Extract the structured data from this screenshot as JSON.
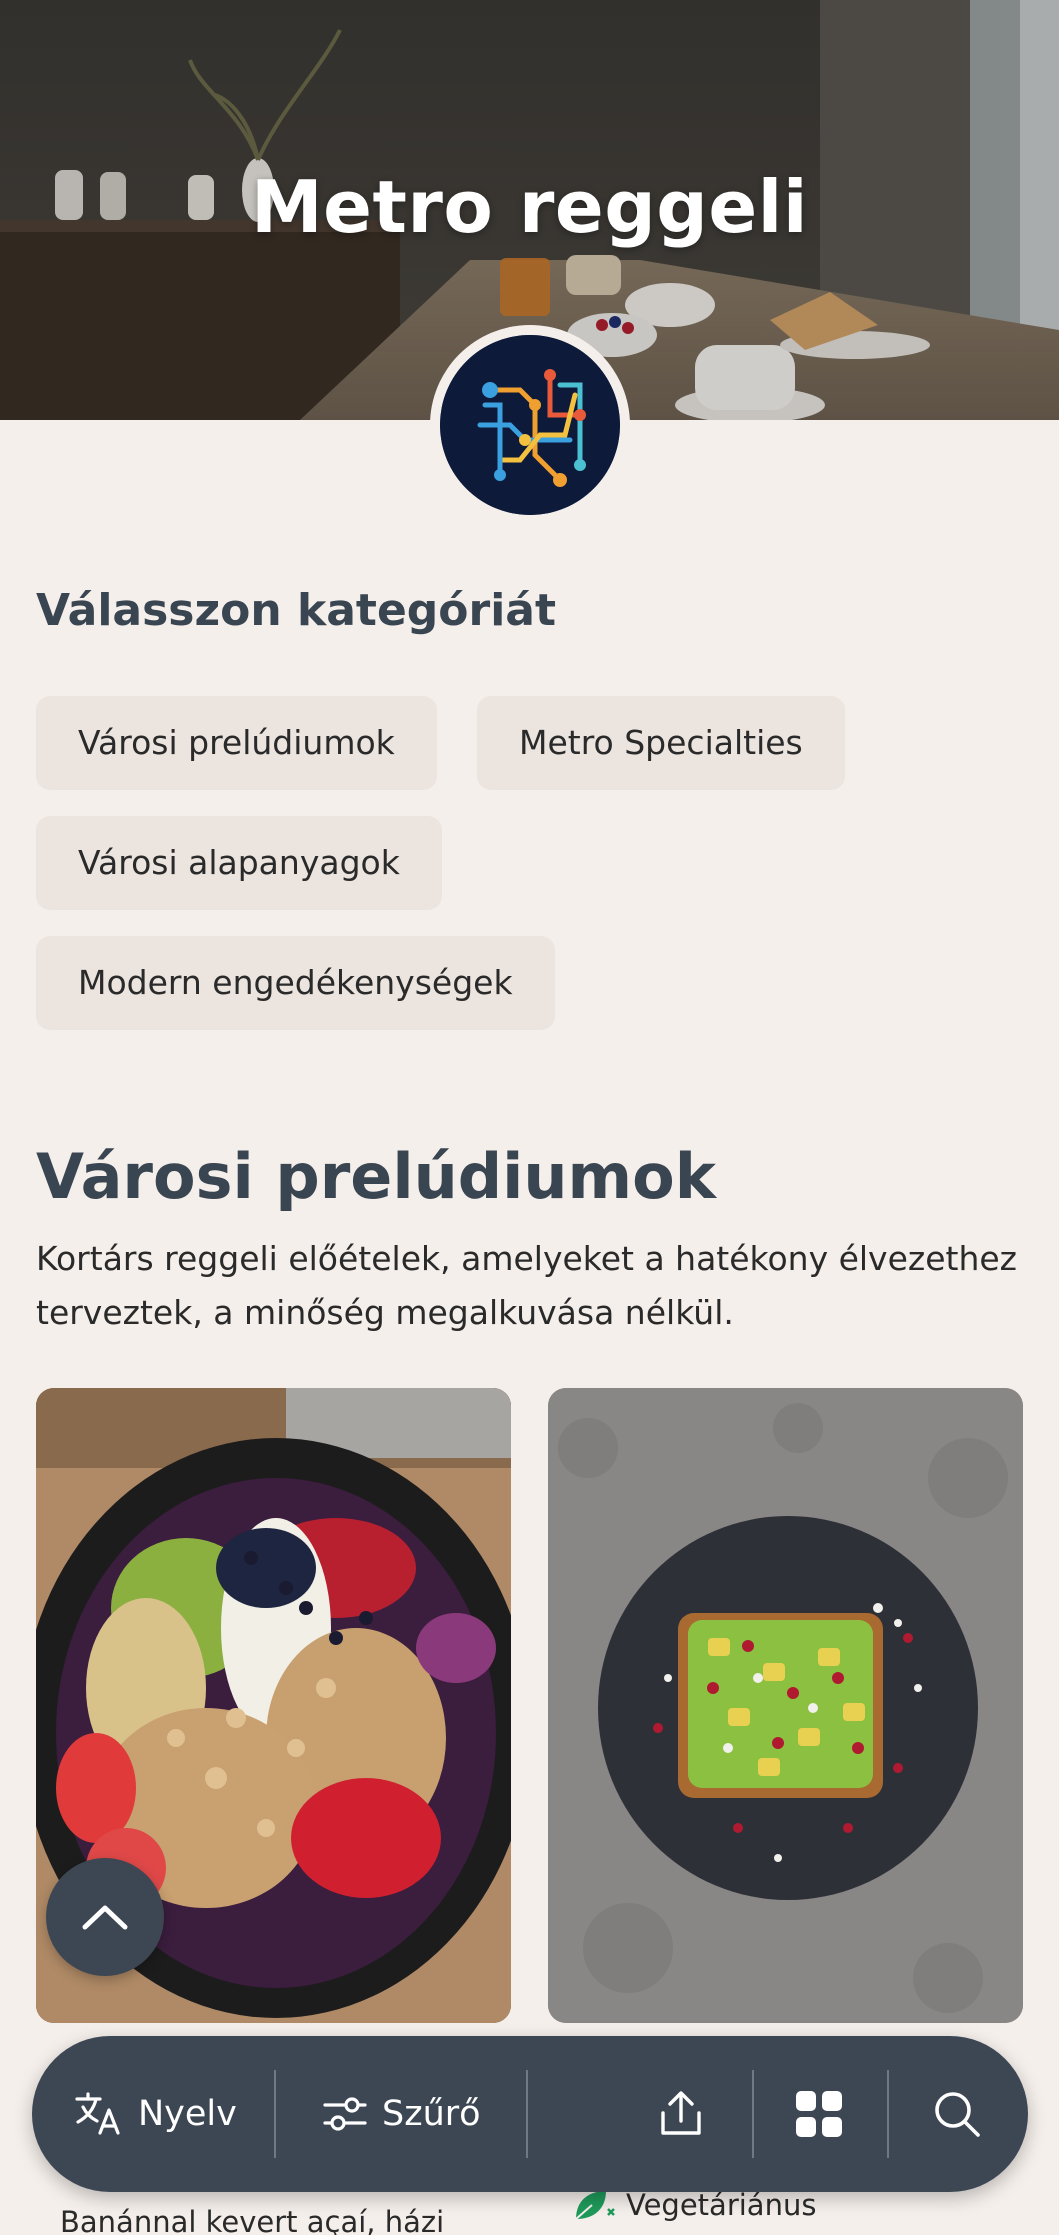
{
  "hero": {
    "title": "Metro reggeli"
  },
  "categories": {
    "heading": "Válasszon kategóriát",
    "items": [
      {
        "label": "Városi prelúdiumok"
      },
      {
        "label": "Metro Specialties"
      },
      {
        "label": "Városi alapanyagok"
      },
      {
        "label": "Modern engedékenységek"
      }
    ]
  },
  "section": {
    "title": "Városi prelúdiumok",
    "description": "Kortárs reggeli előételek, amelyeket a hatékony élvezethez terveztek, a minőség megalkuvása nélkül."
  },
  "cards": [
    {
      "caption": "Banánnal kevert açaí, házi"
    },
    {
      "tag": "Vegetáriánus"
    }
  ],
  "bottom_bar": {
    "language_label": "Nyelv",
    "filter_label": "Szűrő",
    "icons": [
      "translate-icon",
      "filter-icon",
      "share-icon",
      "grid-icon",
      "search-icon"
    ]
  },
  "colors": {
    "background": "#f5efeb",
    "accent": "#3d4753",
    "chip": "#ebe4df",
    "heading": "#3a4552"
  }
}
